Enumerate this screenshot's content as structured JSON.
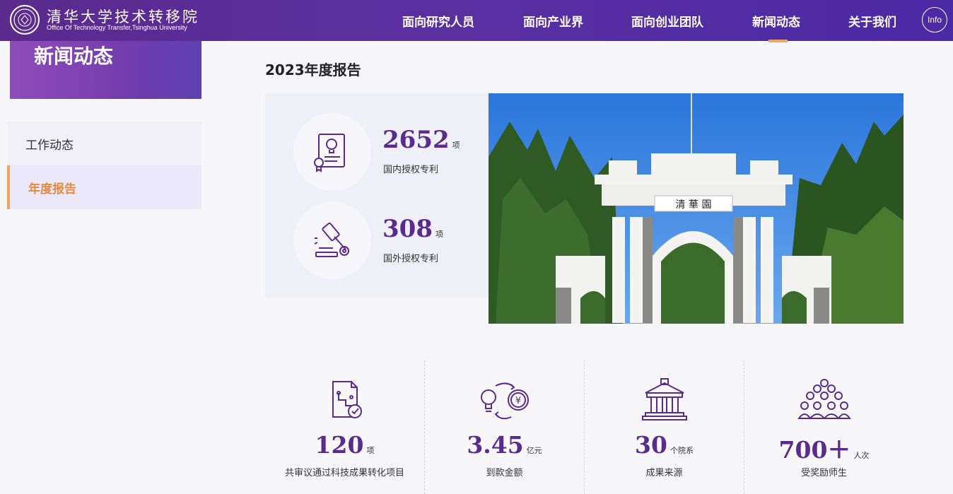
{
  "brand": {
    "name_cn": "清华大学技术转移院",
    "name_en": "Office Of Technology Transfer,Tsinghua University"
  },
  "nav": {
    "items": [
      {
        "label": "面向研究人员"
      },
      {
        "label": "面向产业界"
      },
      {
        "label": "面向创业团队"
      },
      {
        "label": "新闻动态",
        "active": true
      },
      {
        "label": "关于我们"
      }
    ],
    "info_label": "Info"
  },
  "sidebar": {
    "title": "新闻动态",
    "items": [
      {
        "label": "工作动态"
      },
      {
        "label": "年度报告",
        "active": true
      }
    ]
  },
  "main": {
    "title": "2023年度报告",
    "stats_top": [
      {
        "value": "2652",
        "unit": "项",
        "label": "国内授权专利",
        "icon": "certificate-icon"
      },
      {
        "value": "308",
        "unit": "项",
        "label": "国外授权专利",
        "icon": "gavel-icon"
      }
    ],
    "photo_sign": "清 華 園",
    "stats_bottom": [
      {
        "value": "120",
        "unit": "项",
        "label": "共审议通过科技成果转化项目",
        "icon": "document-check-icon"
      },
      {
        "value": "3.45",
        "unit": "亿元",
        "label": "到款金额",
        "icon": "money-exchange-icon"
      },
      {
        "value": "30",
        "unit": "个院系",
        "label": "成果来源",
        "icon": "building-icon"
      },
      {
        "value": "700＋",
        "unit": "人次",
        "label": "受奖励师生",
        "icon": "people-group-icon"
      }
    ]
  },
  "colors": {
    "brand_purple": "#5a2a8c",
    "accent_orange": "#f0a45d"
  }
}
